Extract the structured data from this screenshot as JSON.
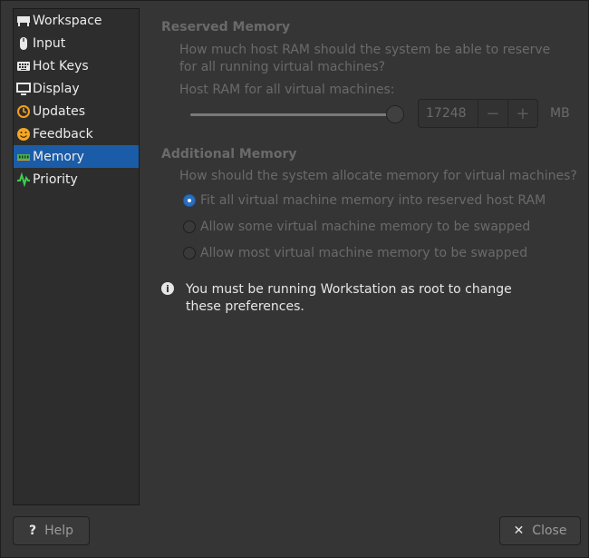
{
  "sidebar": {
    "items": [
      {
        "label": "Workspace",
        "icon": "workspace-icon",
        "selected": false
      },
      {
        "label": "Input",
        "icon": "mouse-icon",
        "selected": false
      },
      {
        "label": "Hot Keys",
        "icon": "keyboard-icon",
        "selected": false
      },
      {
        "label": "Display",
        "icon": "monitor-icon",
        "selected": false
      },
      {
        "label": "Updates",
        "icon": "updates-icon",
        "selected": false
      },
      {
        "label": "Feedback",
        "icon": "smiley-icon",
        "selected": false
      },
      {
        "label": "Memory",
        "icon": "memory-icon",
        "selected": true
      },
      {
        "label": "Priority",
        "icon": "priority-icon",
        "selected": false
      }
    ]
  },
  "reserved": {
    "title": "Reserved Memory",
    "question": "How much host RAM should the system be able to reserve for all running virtual machines?",
    "host_ram_label": "Host RAM for all virtual machines:",
    "value": "17248",
    "unit": "MB",
    "slider_fraction": 1.0,
    "minus": "−",
    "plus": "+"
  },
  "additional": {
    "title": "Additional Memory",
    "question": "How should the system allocate memory for virtual machines?",
    "options": [
      {
        "label": "Fit all virtual machine memory into reserved host RAM",
        "checked": true
      },
      {
        "label": "Allow some virtual machine memory to be swapped",
        "checked": false
      },
      {
        "label": "Allow most virtual machine memory to be swapped",
        "checked": false
      }
    ]
  },
  "info": {
    "icon": "info-icon",
    "text": "You must be running Workstation as root to change these preferences."
  },
  "buttons": {
    "help": "Help",
    "close": "Close"
  },
  "colors": {
    "accent": "#1b5ca8",
    "background": "#353535"
  }
}
